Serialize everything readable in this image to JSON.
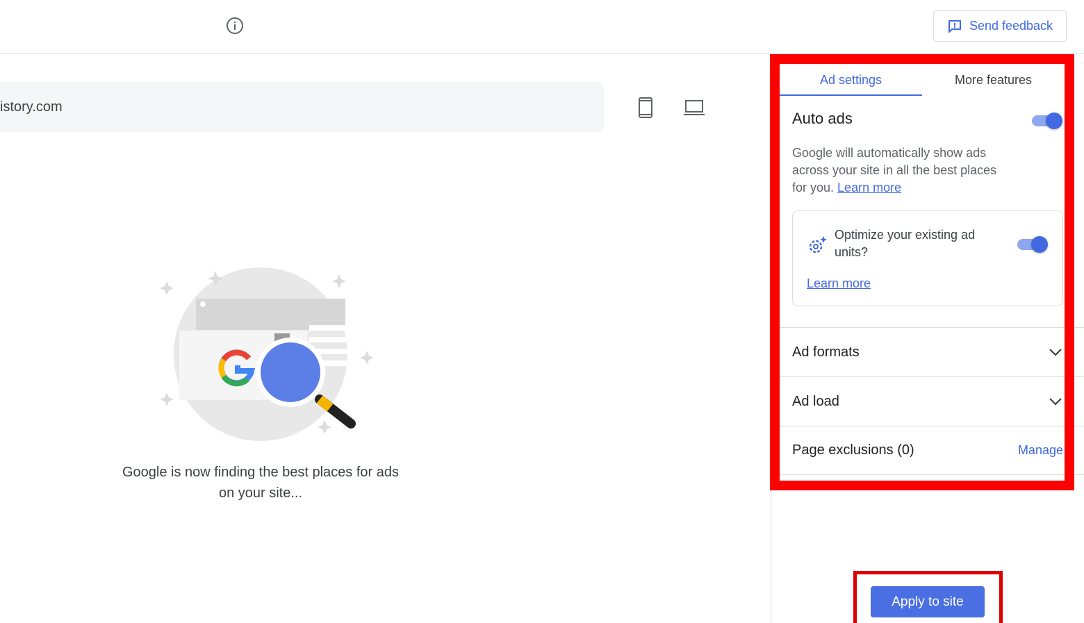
{
  "header": {
    "feedback_label": "Send feedback"
  },
  "preview": {
    "url_text": "istory.com",
    "loading_text": "Google is now finding the best places for ads on your site..."
  },
  "tabs": [
    {
      "label": "Ad settings",
      "active": true
    },
    {
      "label": "More features",
      "active": false
    }
  ],
  "auto_ads": {
    "title": "Auto ads",
    "enabled": true,
    "description": "Google will automatically show ads across your site in all the best places for you.",
    "learn_more": "Learn more"
  },
  "optimize": {
    "text": "Optimize your existing ad units?",
    "enabled": true,
    "learn_more": "Learn more"
  },
  "sections": {
    "ad_formats": "Ad formats",
    "ad_load": "Ad load",
    "page_exclusions": "Page exclusions (0)",
    "manage": "Manage"
  },
  "apply_label": "Apply to site",
  "colors": {
    "accent": "#4169e1",
    "highlight": "#ff0000"
  }
}
